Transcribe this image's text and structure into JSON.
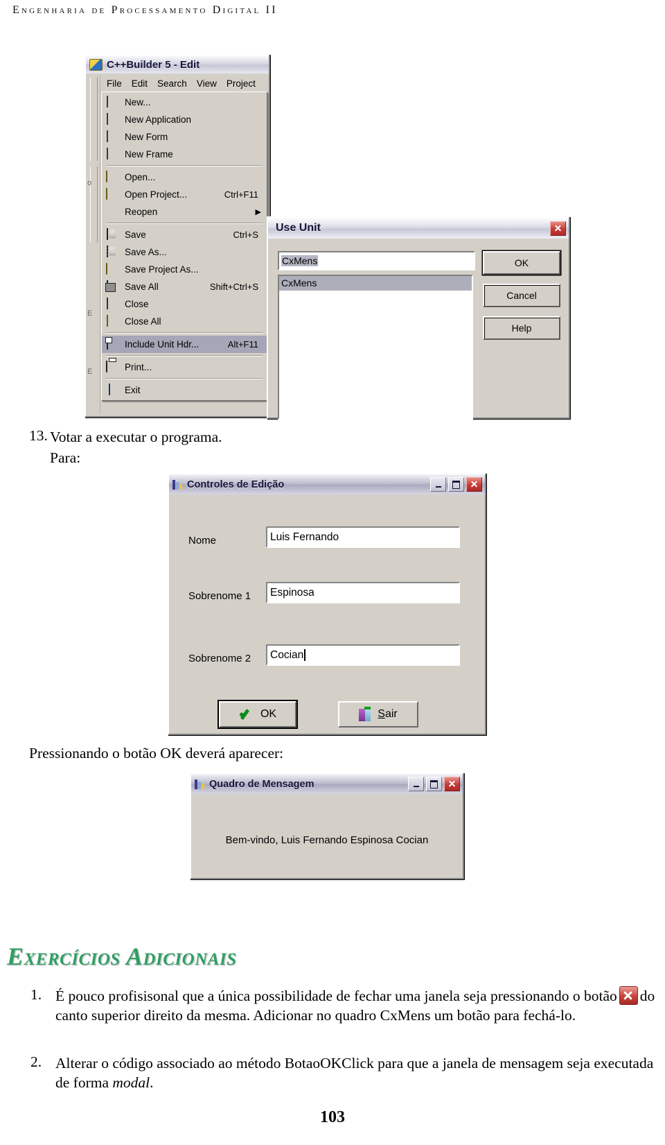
{
  "running_head": "Engenharia de Processamento Digital II",
  "builder_window": {
    "title": "C++Builder 5 - Edit",
    "app_icon": "cppbuilder-icon",
    "menubar": [
      "File",
      "Edit",
      "Search",
      "View",
      "Project"
    ],
    "menu_items": [
      {
        "label": "New...",
        "accel": "",
        "icon": "new-document-icon",
        "selected": false,
        "sep_after": false
      },
      {
        "label": "New Application",
        "accel": "",
        "icon": "new-application-icon",
        "selected": false,
        "sep_after": false
      },
      {
        "label": "New Form",
        "accel": "",
        "icon": "new-form-icon",
        "selected": false,
        "sep_after": false
      },
      {
        "label": "New Frame",
        "accel": "",
        "icon": "new-frame-icon",
        "selected": false,
        "sep_after": true
      },
      {
        "label": "Open...",
        "accel": "",
        "icon": "open-folder-icon",
        "selected": false,
        "sep_after": false
      },
      {
        "label": "Open Project...",
        "accel": "Ctrl+F11",
        "icon": "open-project-icon",
        "selected": false,
        "sep_after": false
      },
      {
        "label": "Reopen",
        "accel": "",
        "icon": "none",
        "selected": false,
        "sep_after": true,
        "submenu": true
      },
      {
        "label": "Save",
        "accel": "Ctrl+S",
        "icon": "save-disk-icon",
        "selected": false,
        "sep_after": false
      },
      {
        "label": "Save As...",
        "accel": "",
        "icon": "save-as-icon",
        "selected": false,
        "sep_after": false
      },
      {
        "label": "Save Project As...",
        "accel": "",
        "icon": "save-project-as-icon",
        "selected": false,
        "sep_after": false
      },
      {
        "label": "Save All",
        "accel": "Shift+Ctrl+S",
        "icon": "save-all-icon",
        "selected": false,
        "sep_after": false
      },
      {
        "label": "Close",
        "accel": "",
        "icon": "close-file-icon",
        "selected": false,
        "sep_after": false
      },
      {
        "label": "Close All",
        "accel": "",
        "icon": "close-all-icon",
        "selected": false,
        "sep_after": true
      },
      {
        "label": "Include Unit Hdr...",
        "accel": "Alt+F11",
        "icon": "include-unit-icon",
        "selected": true,
        "sep_after": true
      },
      {
        "label": "Print...",
        "accel": "",
        "icon": "printer-icon",
        "selected": false,
        "sep_after": true
      },
      {
        "label": "Exit",
        "accel": "",
        "icon": "exit-icon",
        "selected": false,
        "sep_after": false
      }
    ]
  },
  "use_unit_dialog": {
    "title": "Use Unit",
    "edit_value": "CxMens",
    "list_items": [
      "CxMens"
    ],
    "buttons": {
      "ok": "OK",
      "cancel": "Cancel",
      "help": "Help"
    },
    "close_button": "close-icon"
  },
  "step13": {
    "number": "13.",
    "text": "Votar a executar o programa.",
    "sub": "Para:"
  },
  "edit_controls_window": {
    "title": "Controles de Edição",
    "app_icon": "application-icon",
    "fields": [
      {
        "label": "Nome",
        "value": "Luis Fernando",
        "caret": false
      },
      {
        "label": "Sobrenome 1",
        "value": "Espinosa",
        "caret": false
      },
      {
        "label": "Sobrenome 2",
        "value": "Cocian",
        "caret": true
      }
    ],
    "buttons": [
      {
        "label": "OK",
        "icon": "green-check-icon",
        "default": true
      },
      {
        "label": "Sair",
        "icon": "exit-door-icon",
        "default": false,
        "accel_letter": "S"
      }
    ],
    "titlebar_buttons": [
      "minimize-icon",
      "maximize-icon",
      "close-icon"
    ]
  },
  "caption_after_form": "Pressionando o botão OK deverá aparecer:",
  "message_window": {
    "title": "Quadro de Mensagem",
    "app_icon": "application-icon",
    "message": "Bem-vindo, Luis Fernando Espinosa Cocian",
    "titlebar_buttons": [
      "minimize-icon",
      "maximize-icon",
      "close-icon"
    ]
  },
  "exercises": {
    "heading": "Exercícios Adicionais",
    "items": [
      {
        "number": "1.",
        "part1": "É pouco profisisonal que a única possibilidade de fechar uma janela seja pressionando o botão",
        "inline_icon": "red-close-icon",
        "part2": "do canto superior direito da mesma. Adicionar no quadro CxMens um botão para fechá-lo."
      },
      {
        "number": "2.",
        "part1": "Alterar o código associado ao método BotaoOKClick para que a janela de mensagem seja executada de forma",
        "italic_word": "modal",
        "part2": "."
      }
    ]
  },
  "page_number": "103",
  "colors": {
    "heading_green": "#2f9e63",
    "close_red": "#c7423c",
    "window_face": "#d4d0c8",
    "menu_selection": "#a6a6b8"
  }
}
